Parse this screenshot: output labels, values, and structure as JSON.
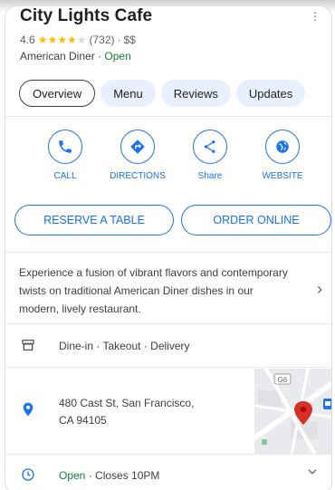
{
  "place": {
    "name": "City Lights Cafe",
    "rating": "4.6",
    "stars_value": 4.6,
    "reviews": "(732)",
    "price": "$$",
    "category": "American Diner",
    "status": "Open"
  },
  "tabs": [
    {
      "label": "Overview",
      "active": true
    },
    {
      "label": "Menu"
    },
    {
      "label": "Reviews"
    },
    {
      "label": "Updates"
    }
  ],
  "actions": [
    {
      "label": "CALL",
      "icon": "phone-icon"
    },
    {
      "label": "DIRECTIONS",
      "icon": "directions-icon"
    },
    {
      "label": "Share",
      "icon": "share-icon"
    },
    {
      "label": "WEBSITE",
      "icon": "globe-icon"
    }
  ],
  "buttons": {
    "reserve": "RESERVE A TABLE",
    "order": "ORDER ONLINE"
  },
  "description": "Experience a fusion of vibrant flavors and contemporary twists on traditional American Diner dishes in our modern, lively restaurant.",
  "services": "Dine-in · Takeout · Delivery",
  "address": {
    "line1": "480 Cast St, San Francisco,",
    "line2": "CA 94105"
  },
  "map": {
    "route_label": "G6"
  },
  "hours": {
    "status": "Open",
    "closes": "Closes 10PM"
  },
  "colors": {
    "accent": "#1a73e8",
    "open": "#188038",
    "star": "#fbbc04",
    "pin": "#d93025"
  }
}
